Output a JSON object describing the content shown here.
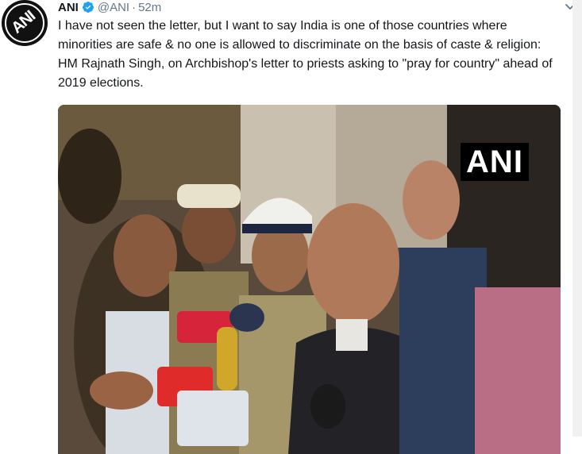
{
  "tweet": {
    "author_name": "ANI",
    "handle": "@ANI",
    "separator": "·",
    "time": "52m",
    "text": "I have not seen the letter, but I want to say India is one of those countries where minorities are safe & no one is allowed to discriminate on the basis of caste & religion: HM Rajnath Singh, on Archbishop's letter to priests asking to \"pray for country\" ahead of 2019 elections.",
    "avatar_label": "ANI",
    "media_watermark": "ANI",
    "icons": [
      "verified-badge-icon",
      "chevron-down-icon"
    ]
  },
  "colors": {
    "text": "#14171a",
    "muted": "#657786",
    "verified": "#1da1f2"
  }
}
